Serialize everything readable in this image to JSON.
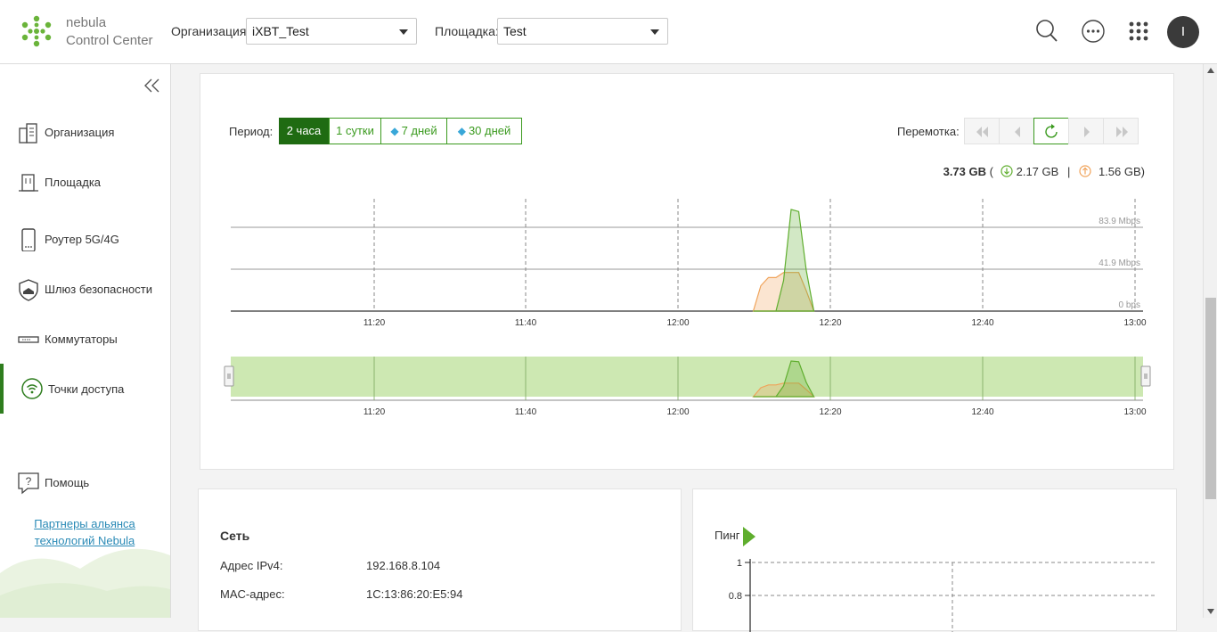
{
  "logo": {
    "line1": "nebula",
    "line2": "Control Center"
  },
  "header": {
    "org_label": "Организация:",
    "org_value": "iXBT_Test",
    "site_label": "Площадка:",
    "site_value": "Test",
    "avatar_letter": "I"
  },
  "sidebar": {
    "items": [
      {
        "label": "Организация"
      },
      {
        "label": "Площадка"
      },
      {
        "label": "Роутер 5G/4G"
      },
      {
        "label": "Шлюз безопасности"
      },
      {
        "label": "Коммутаторы"
      },
      {
        "label": "Точки доступа"
      }
    ],
    "help": "Помощь",
    "partners_line1": "Партнеры альянса",
    "partners_line2": "технологий Nebula"
  },
  "traffic": {
    "period_label": "Период:",
    "periods": [
      "2 часа",
      "1 сутки",
      "7 дней",
      "30 дней"
    ],
    "active_period": "2 часа",
    "rewind_label": "Перемотка:",
    "total": "3.73 GB",
    "down": "2.17 GB",
    "up": "1.56 GB",
    "open_paren": "(",
    "sep": "|",
    "close_paren": ")"
  },
  "chart_data": {
    "type": "area",
    "x_ticks": [
      "11:20",
      "11:40",
      "12:00",
      "12:20",
      "12:40",
      "13:00"
    ],
    "y_ticks": [
      "0 bps",
      "41.9 Mbps",
      "83.9 Mbps"
    ],
    "ylim": [
      0,
      83.9
    ],
    "y_unit": "Mbps",
    "x": [
      "12:19",
      "12:20",
      "12:21",
      "12:22",
      "12:23",
      "12:24",
      "12:25",
      "12:26",
      "12:27"
    ],
    "series": [
      {
        "name": "download",
        "color": "#5fae2e",
        "values": [
          0,
          0,
          0,
          0,
          30,
          100,
          98,
          40,
          0
        ]
      },
      {
        "name": "upload",
        "color": "#f0a35a",
        "values": [
          0,
          25,
          33,
          33,
          38,
          38,
          38,
          20,
          0
        ]
      }
    ],
    "navigator": {
      "x_ticks": [
        "11:20",
        "11:40",
        "12:00",
        "12:20",
        "12:40",
        "13:00"
      ],
      "range_fill": "#cde8b2"
    }
  },
  "network": {
    "title": "Сеть",
    "ipv4_label": "Адрес IPv4:",
    "ipv4_value": "192.168.8.104",
    "mac_label": "MAC-адрес:",
    "mac_value": "1C:13:86:20:E5:94"
  },
  "ping": {
    "label": "Пинг",
    "y_ticks": [
      "1",
      "0.8"
    ]
  }
}
